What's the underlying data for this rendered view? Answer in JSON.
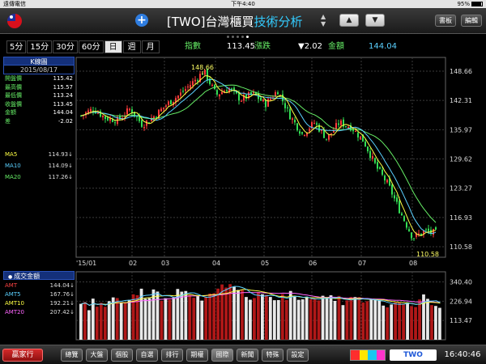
{
  "status_bar": {
    "carrier": "遠傳電信",
    "clock": "下午4:40",
    "battery": "95%",
    "battery_level": 0.95
  },
  "header": {
    "title_symbol": "[TWO]",
    "title_group": "台灣櫃買",
    "title_name": "技術分析",
    "up_label": "▲",
    "down_label": "▼",
    "book_label": "書板",
    "edit_label": "編輯"
  },
  "intervals": {
    "items": [
      "5分",
      "15分",
      "30分",
      "60分",
      "日",
      "週",
      "月"
    ],
    "active_index": 4
  },
  "quote": {
    "index_label": "指數",
    "index_value": "113.45",
    "change_label": "漲跌",
    "change_value": "▼2.02",
    "amount_label": "金額",
    "amount_value": "144.04"
  },
  "k_panel": {
    "title": "K線圖",
    "date": "2015/08/17",
    "rows": [
      {
        "label": "開盤價",
        "value": "115.42"
      },
      {
        "label": "最高價",
        "value": "115.57"
      },
      {
        "label": "最低價",
        "value": "113.24"
      },
      {
        "label": "收盤價",
        "value": "113.45"
      },
      {
        "label": "金額",
        "value": "144.04"
      },
      {
        "label": "差",
        "value": "-2.02"
      }
    ],
    "ma": [
      {
        "label": "MA5",
        "value": "114.93↓",
        "color": "#ffff44"
      },
      {
        "label": "MA10",
        "value": "114.09↓",
        "color": "#5ad0ff"
      },
      {
        "label": "MA20",
        "value": "117.26↓",
        "color": "#66ee66"
      }
    ]
  },
  "volume_panel": {
    "title": "成交金額",
    "rows": [
      {
        "label": "AMT",
        "value": "144.04↓",
        "color": "#ff4444"
      },
      {
        "label": "AMT5",
        "value": "167.76↓",
        "color": "#5ad0ff"
      },
      {
        "label": "AMT10",
        "value": "192.21↓",
        "color": "#ffff44"
      },
      {
        "label": "AMT20",
        "value": "207.42↓",
        "color": "#ff66ff"
      }
    ]
  },
  "toolbar": {
    "logo": "贏家行",
    "items": [
      "總覽",
      "大盤",
      "個股",
      "自選",
      "排行",
      "期權",
      "國際",
      "新聞",
      "特殊",
      "設定"
    ],
    "active_index": 6,
    "symbol": "TWO",
    "time": "16:40:46"
  },
  "chart_data": [
    {
      "type": "candlestick",
      "title": "",
      "x_ticks": [
        "'15/01",
        "02",
        "03",
        "04",
        "05",
        "06",
        "07",
        "08"
      ],
      "y_ticks": [
        148.66,
        142.31,
        135.97,
        129.62,
        123.27,
        116.93,
        110.58
      ],
      "ylim": [
        110.58,
        148.66
      ],
      "grid": true,
      "annotations": [
        {
          "text": "148.66",
          "label": "high"
        },
        {
          "text": "110.58",
          "label": "low"
        }
      ],
      "series": [
        {
          "name": "MA5",
          "color": "#ffff44"
        },
        {
          "name": "MA10",
          "color": "#5ad0ff"
        },
        {
          "name": "MA20",
          "color": "#66ee66"
        }
      ],
      "close_path": [
        [
          "'15/01",
          139
        ],
        [
          "01",
          140.5
        ],
        [
          "01",
          138.5
        ],
        [
          "02",
          138
        ],
        [
          "02",
          140.5
        ],
        [
          "02",
          137
        ],
        [
          "03",
          139
        ],
        [
          "03",
          141.5
        ],
        [
          "03",
          143.5
        ],
        [
          "04",
          146
        ],
        [
          "04",
          148.66
        ],
        [
          "04",
          143.5
        ],
        [
          "04",
          145
        ],
        [
          "05",
          142.5
        ],
        [
          "05",
          143.8
        ],
        [
          "05",
          141.5
        ],
        [
          "05",
          144.5
        ],
        [
          "06",
          139
        ],
        [
          "06",
          135
        ],
        [
          "06",
          137.5
        ],
        [
          "06",
          134
        ],
        [
          "07",
          137.5
        ],
        [
          "07",
          136.5
        ],
        [
          "07",
          133.5
        ],
        [
          "07",
          128
        ],
        [
          "07",
          124
        ],
        [
          "08",
          118
        ],
        [
          "08",
          112.5
        ],
        [
          "08",
          114
        ],
        [
          "08",
          113.45
        ]
      ]
    },
    {
      "type": "bar",
      "title": "",
      "y_ticks": [
        340.4,
        226.94,
        113.47
      ],
      "ylim": [
        0,
        400
      ],
      "series": [
        {
          "name": "AMT",
          "color": "#c02020"
        },
        {
          "name": "AMT5",
          "color": "#5ad0ff"
        },
        {
          "name": "AMT10",
          "color": "#ffff44"
        },
        {
          "name": "AMT20",
          "color": "#ff66ff"
        }
      ],
      "amt_levels": [
        200,
        215,
        190,
        230,
        210,
        205,
        195,
        220,
        240,
        260,
        210,
        230,
        250,
        270,
        260,
        290,
        250,
        260,
        300,
        280,
        240,
        250,
        230,
        260,
        280,
        270,
        290,
        260,
        250,
        270,
        230,
        240,
        260,
        290,
        310,
        320,
        300,
        340,
        330,
        290,
        280,
        260,
        250,
        240,
        270,
        260,
        250,
        240,
        230,
        220,
        260,
        250,
        270,
        240,
        230,
        240,
        250,
        240,
        230,
        250,
        240,
        260,
        250,
        230,
        240,
        220,
        240,
        250,
        260,
        240,
        230,
        220,
        250,
        240,
        230,
        220,
        200,
        210,
        220,
        230,
        210,
        200,
        190,
        210,
        230,
        250,
        240,
        220,
        210,
        200
      ]
    }
  ]
}
